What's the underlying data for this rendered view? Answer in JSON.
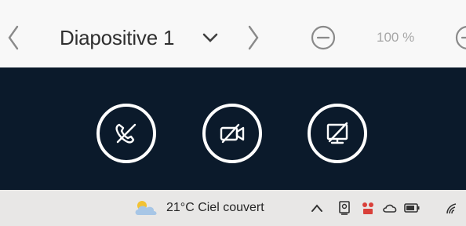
{
  "toolbar": {
    "slide_title": "Diapositive 1",
    "zoom_level": "100 %",
    "icons": [
      "chevron-left-icon",
      "chevron-down-icon",
      "chevron-right-icon",
      "zoom-out-icon",
      "zoom-in-icon"
    ]
  },
  "call_controls": {
    "background": "#0b1a2b",
    "buttons": [
      "hang-up-icon",
      "video-off-icon",
      "screen-share-off-icon"
    ]
  },
  "taskbar": {
    "weather": "21°C Ciel couvert",
    "tray_icons": [
      "chevron-up-icon",
      "meet-now-icon",
      "app-tray-icon",
      "cloud-icon",
      "battery-icon",
      "wifi-icon"
    ]
  }
}
